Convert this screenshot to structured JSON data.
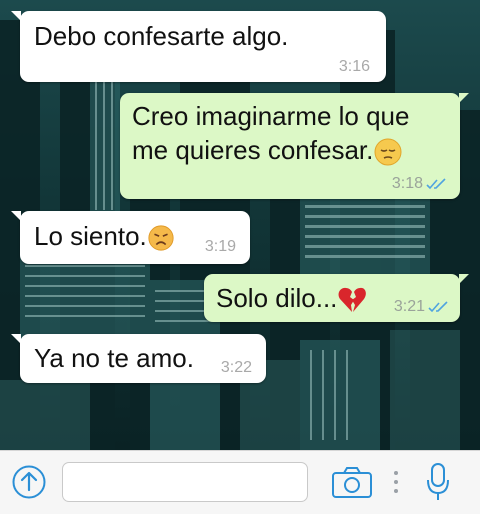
{
  "chat": {
    "messages": [
      {
        "direction": "incoming",
        "text": "Debo confesarte algo.",
        "time": "3:16"
      },
      {
        "direction": "outgoing",
        "text_line1": "Creo imaginarme lo que",
        "text_line2": "me quieres confesar.",
        "emoji": "pensive-face-emoji",
        "time": "3:18",
        "status": "read"
      },
      {
        "direction": "incoming",
        "text": "Lo siento.",
        "emoji": "sad-face-emoji",
        "time": "3:19"
      },
      {
        "direction": "outgoing",
        "text": "Solo dilo...",
        "emoji": "broken-heart-emoji",
        "time": "3:21",
        "status": "read"
      },
      {
        "direction": "incoming",
        "text": "Ya no te amo.",
        "time": "3:22"
      }
    ]
  },
  "composer": {
    "placeholder": "",
    "icons": [
      "share-up-icon",
      "camera-icon",
      "more-dots-icon",
      "microphone-icon"
    ]
  },
  "colors": {
    "incoming_bubble": "#ffffff",
    "outgoing_bubble": "#dcf8c6",
    "read_ticks": "#4fa3e0",
    "accent": "#2b8fd6"
  }
}
